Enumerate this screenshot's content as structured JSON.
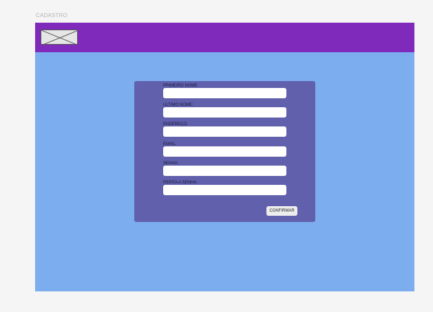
{
  "page": {
    "label": "CADASTRO"
  },
  "header": {
    "logo_icon": "image-placeholder-icon",
    "color": "#7f2abb"
  },
  "form": {
    "fields": [
      {
        "label": "PRIMEIRO NOME:",
        "value": "",
        "placeholder": ""
      },
      {
        "label": "ULTIMO NOME:",
        "value": "",
        "placeholder": ""
      },
      {
        "label": "ENDEREÇO:",
        "value": "",
        "placeholder": ""
      },
      {
        "label": "EMAIL:",
        "value": "",
        "placeholder": ""
      },
      {
        "label": "SENHA:",
        "value": "",
        "placeholder": ""
      },
      {
        "label": "REPITA A SENHA:",
        "value": "",
        "placeholder": ""
      }
    ],
    "confirm_label": "CONFIRMAR"
  },
  "colors": {
    "background": "#7cadee",
    "card": "#6160ac",
    "header": "#7f2abb"
  }
}
